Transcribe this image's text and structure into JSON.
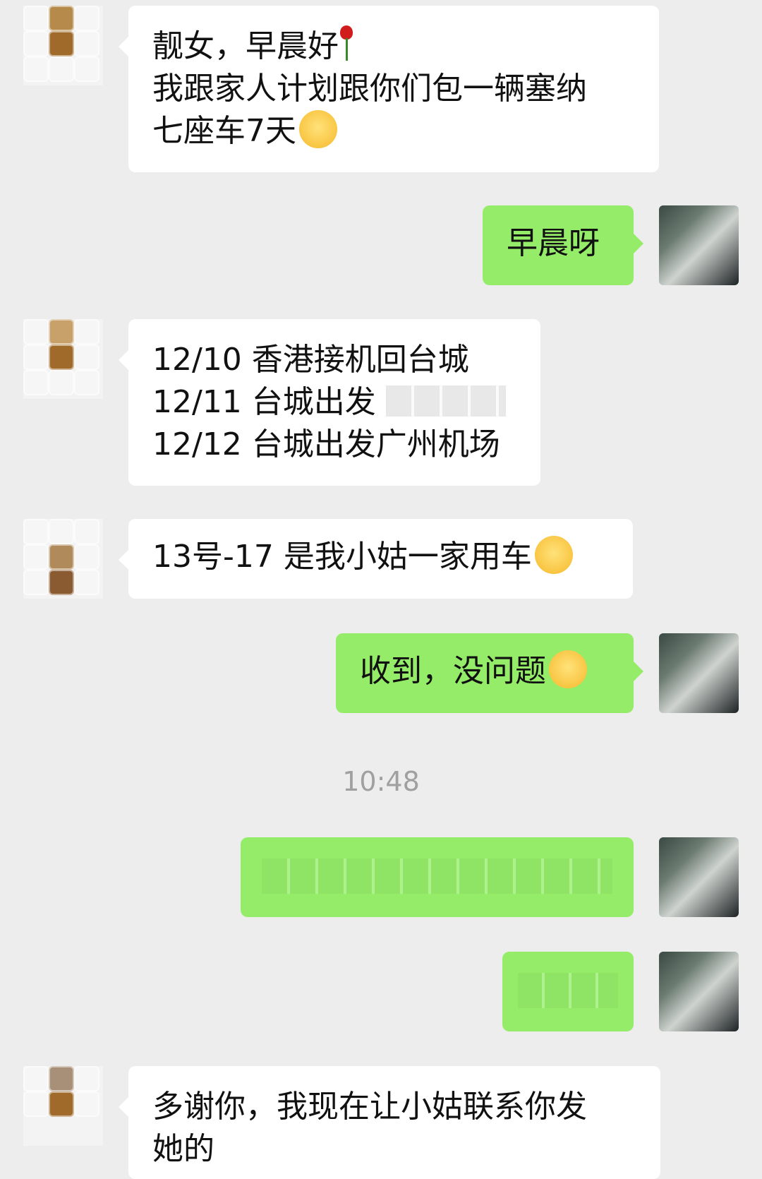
{
  "messages": [
    {
      "side": "left",
      "lines": [
        "靓女，早晨好",
        "我跟家人计划跟你们包一辆塞纳",
        "七座车7天"
      ]
    },
    {
      "side": "right",
      "lines": [
        "早晨呀"
      ]
    },
    {
      "side": "left",
      "lines": [
        "12/10 香港接机回台城",
        "12/11  台城出发",
        "12/12 台城出发广州机场"
      ]
    },
    {
      "side": "left",
      "lines": [
        "13号-17 是我小姑一家用车"
      ]
    },
    {
      "side": "right",
      "lines": [
        "收到，没问题"
      ]
    },
    {
      "side": "left",
      "lines": [
        "多谢你，我现在让小姑联系你发",
        "她的"
      ]
    }
  ],
  "timestamp": "10:48",
  "emoji_icons": [
    "rose-icon",
    "smile-emoji-icon",
    "grin-emoji-icon",
    "think-emoji-icon"
  ],
  "colors": {
    "background": "#ededed",
    "incoming_bubble": "#ffffff",
    "outgoing_bubble": "#95ec69",
    "timestamp_text": "#a0a0a0"
  }
}
